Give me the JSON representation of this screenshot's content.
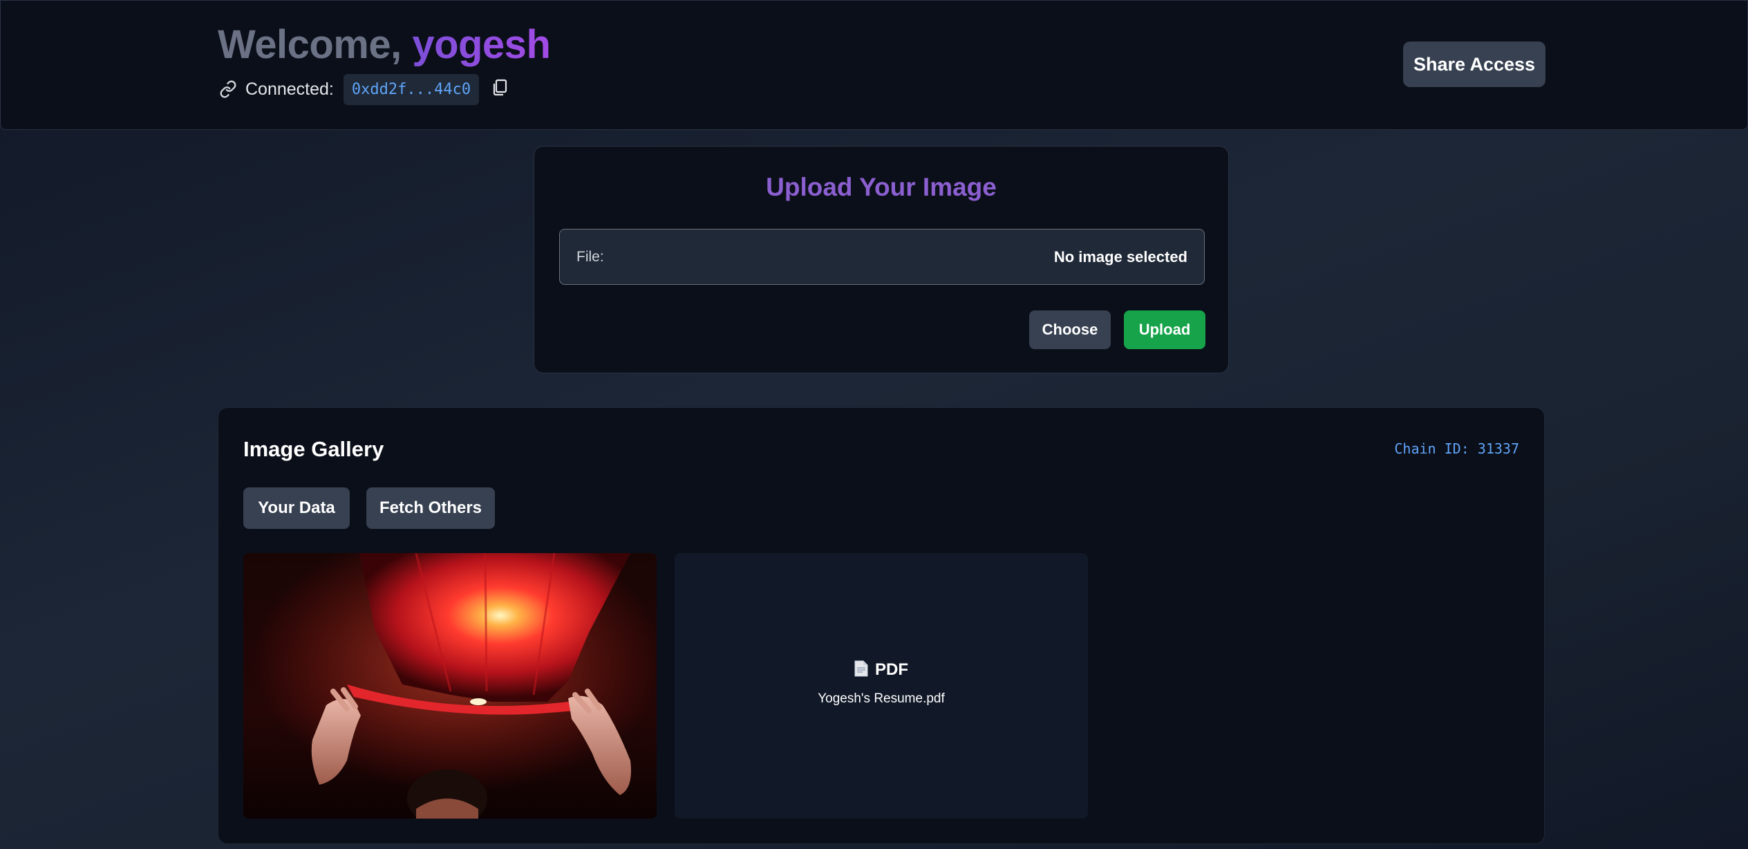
{
  "header": {
    "welcome_prefix": "Welcome, ",
    "user_name": "yogesh",
    "connected_label": "Connected:",
    "wallet_address": "0xdd2f...44c0",
    "share_button": "Share Access"
  },
  "upload": {
    "title": "Upload Your Image",
    "file_label": "File:",
    "file_value": "No image selected",
    "choose_button": "Choose",
    "upload_button": "Upload"
  },
  "gallery": {
    "title": "Image Gallery",
    "chain_id": "Chain ID: 31337",
    "tabs": [
      "Your Data",
      "Fetch Others"
    ],
    "items": [
      {
        "kind": "image"
      },
      {
        "kind": "pdf",
        "type_label": "PDF",
        "file_name": "Yogesh's Resume.pdf"
      }
    ]
  },
  "colors": {
    "accent_purple": "#8b5fd0",
    "address_blue": "#60a5fa",
    "upload_green": "#16a34a",
    "button_gray": "#374151",
    "panel_bg": "#0b0f19"
  },
  "icons": [
    "link-icon",
    "copy-icon",
    "document-icon"
  ]
}
